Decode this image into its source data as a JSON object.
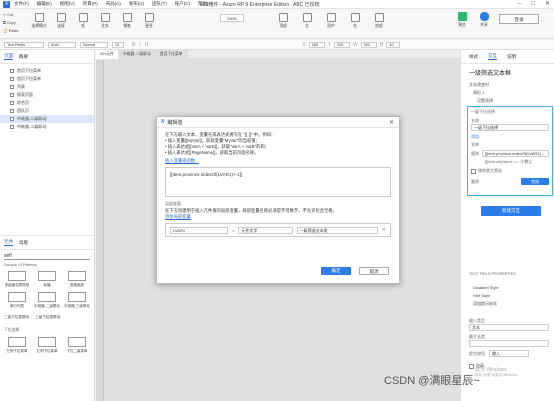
{
  "titlebar": {
    "menu": [
      "文件(F)",
      "编辑(E)",
      "视图(V)",
      "项目(P)",
      "布局(A)",
      "发布(U)",
      "团队(T)",
      "账户(C)",
      "帮助(H)"
    ],
    "notice": "本工具使用仅作学习、研究等用途，请勿用于商业用途！",
    "window_title": "001元件 - Axure RP 9 Enterprise Edition : ABC 已授权"
  },
  "toolbar": {
    "clipboard": [
      "Cut",
      "Copy",
      "Paste"
    ],
    "tools": [
      "选择模式",
      "连接",
      "矩",
      "文本",
      "钢笔",
      "更多"
    ],
    "zoom": "100%",
    "more_tools": [
      "顶部",
      "左",
      "居中",
      "右",
      "底部"
    ],
    "right_buttons": [
      "预览",
      "共享",
      "登录"
    ]
  },
  "formatbar": {
    "style": "Text Fields",
    "font": "Arial",
    "weight": "Normal",
    "size": "13",
    "x": "265",
    "y": "249",
    "w": "300",
    "h": "40"
  },
  "leftpanel": {
    "tabs": [
      "页面",
      "概要"
    ],
    "pages": [
      "首页下拉菜单",
      "首页下拉菜单",
      "列表",
      "搜索页面",
      "综合页",
      "团队页",
      "中继器-二级联动",
      "中继器-二级联动"
    ],
    "lib_tabs": [
      "元件",
      "母版"
    ],
    "search": "self",
    "library_name": "Sample UI Patterns",
    "widgets_row1": [
      "多级面包屑导航",
      "轮播",
      "表格面板"
    ],
    "widgets_row2": [
      "单行列表",
      "中继器-二级联动",
      "中继器-三级联动"
    ],
    "widgets_row3": [
      "二级下拉框联动",
      "三级下拉框联动"
    ],
    "section2": "下拉选择",
    "widgets_row4": [
      "左侧下拉菜单",
      "左侧下拉菜单",
      "下拉二级菜单"
    ]
  },
  "canvas": {
    "tabs": [
      "001元件",
      "中继器-二级联动",
      "首页下拉菜单"
    ]
  },
  "dialog": {
    "title": "编辑值",
    "intro": "在下方输入文本，变量名或表达式要写在 \"[[ ]]\" 中。例如：",
    "examples": [
      "• 插入变量[[MyVar]]，获取变量\"MyVar\"的当前值；",
      "• 插入表达式[[VarA + VarB]]，获取\"VarA + VarB\"的和；",
      "• 插入表达式[[PageName]]，获取当前页面名称。"
    ],
    "insert_link": "插入变量或函数...",
    "expression": "[[Item.province.indexOf(LVAR1)>-1]]",
    "local_var_header": "局部变量",
    "local_var_desc": "在下方创建用于插入元件值的局部变量，局部变量名称必须是字母数字，不允许包含空格。",
    "add_var_link": "添加局部变量",
    "var_name": "LVAR1",
    "var_op": "=",
    "var_type": "元件文字",
    "var_target": "一级筛选文本框",
    "ok": "确定",
    "cancel": "取消"
  },
  "rightpanel": {
    "tabs": [
      "样式",
      "交互",
      "说明"
    ],
    "element_title": "一级筛选文本框",
    "event_label": "文本改变时",
    "case_label": "情形 1",
    "action_label": "设置选择",
    "popup_title": "一级下拉选择",
    "popup_name_label": "名称",
    "popup_name_value": "一级下拉选择",
    "filter_label": "添加",
    "filter_name_label": "名称",
    "filter_rule_label": "规则",
    "filter_rule_value": "[[Item.province.indexOf(LVAR1)...",
    "filter_rule2": "[[Item.cityName == '小数']]",
    "remove_other": "移除其它筛选",
    "delete_label": "删除",
    "done_label": "完成",
    "new_interaction": "新建交互",
    "text_field_props": "TEXT FIELD PROPERTIES",
    "props": [
      "Disabled Style",
      "Hint Style",
      "添加提示样式"
    ],
    "input_type_label": "输入类型",
    "input_type_value": "文本",
    "max_length_label": "最大长度",
    "submit_label": "提交按钮",
    "submit_value": "输入",
    "readonly_label": "隐藏",
    "watermark_line1": "激活 Windows",
    "watermark_line2": "转到\"设置\"以激活 Windows。"
  },
  "footer": {
    "credit": "CSDN @满眼星辰~"
  }
}
